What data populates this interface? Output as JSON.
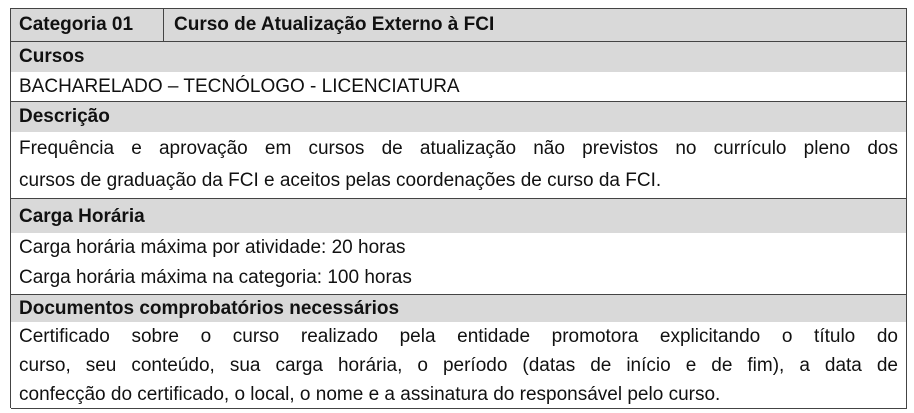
{
  "header": {
    "category_number": "Categoria 01",
    "category_title": "Curso de Atualização Externo à FCI"
  },
  "cursos": {
    "title": "Cursos",
    "text": "BACHARELADO – TECNÓLOGO - LICENCIATURA"
  },
  "descricao": {
    "title": "Descrição",
    "lines": [
      "Frequência e aprovação em cursos de atualização não previstos no currículo pleno dos",
      "cursos de graduação da FCI e aceitos pelas coordenações de curso da FCI."
    ]
  },
  "carga_horaria": {
    "title": "Carga Horária",
    "lines": [
      "Carga horária máxima por atividade: 20 horas",
      "Carga horária máxima na categoria: 100 horas"
    ]
  },
  "documentos": {
    "title": "Documentos comprobatórios necessários",
    "lines": [
      "Certificado sobre o curso realizado pela entidade promotora explicitando o título do",
      "curso, seu conteúdo, sua carga horária, o período (datas de início e de fim), a data de",
      "confecção do certificado, o local, o nome e a assinatura do responsável pelo curso."
    ]
  }
}
